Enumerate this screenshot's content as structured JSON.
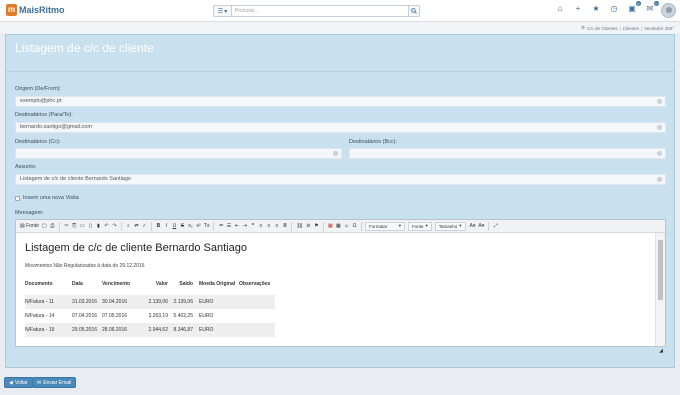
{
  "app": {
    "logo_letter": "m",
    "logo_text": "MaisRitmo"
  },
  "search": {
    "type_icon": "list-icon",
    "placeholder": "Procurar...",
    "button_icon": "search-icon"
  },
  "top_icons": [
    {
      "name": "home-icon",
      "glyph": "⌂"
    },
    {
      "name": "plus-icon",
      "glyph": "+"
    },
    {
      "name": "star-icon",
      "glyph": "★"
    },
    {
      "name": "clock-icon",
      "glyph": "◷"
    },
    {
      "name": "notifications-icon",
      "glyph": "▣",
      "badge": "0"
    },
    {
      "name": "messages-icon",
      "glyph": "✉",
      "badge": "0"
    }
  ],
  "breadcrumb": {
    "items": [
      "C/c de Clientes",
      "Clientes",
      "Vendedor 360°"
    ]
  },
  "page": {
    "title": "Listagem de c/c de cliente"
  },
  "form": {
    "origin_label": "Origem (De/From):",
    "origin_value": "exemplo@phc.pt",
    "to_label": "Destinatários (Para/To):",
    "to_value": "bernardo.santigo@gmail.com",
    "cc_label": "Destinatários (Cc):",
    "cc_value": "",
    "bcc_label": "Destinatários (Bcc):",
    "bcc_value": "",
    "subject_label": "Assunto:",
    "subject_value": "Listagem de c/c de cliente Bernardo Santiago",
    "new_visit_label": "Inserir uma nova Visita",
    "message_label": "Mensagem:"
  },
  "toolbar": {
    "source_label": "Fonte",
    "format_label": "Formatar",
    "font_label": "Fonte",
    "size_label": "Tamanho"
  },
  "email": {
    "title": "Listagem de c/c de cliente Bernardo Santiago",
    "subtitle": "Movimentos Não Regularizados à data de 29.12.2016",
    "columns": [
      "Documento",
      "Data",
      "Vencimento",
      "Valor",
      "Saldo",
      "Moeda Original",
      "Observações"
    ],
    "rows": [
      [
        "N/Fatura - 11",
        "31.03.2016",
        "30.04.2016",
        "2.139,06",
        "2.139,06",
        "EURO",
        ""
      ],
      [
        "N/Fatura - 14",
        "07.04.2016",
        "07.05.2016",
        "3.263,19",
        "5.402,25",
        "EURO",
        ""
      ],
      [
        "N/Fatura - 19",
        "29.05.2016",
        "28.06.2016",
        "2.944,62",
        "8.346,87",
        "EURO",
        ""
      ]
    ]
  },
  "footer": {
    "back_label": "Voltar",
    "send_label": "Enviar Email"
  }
}
